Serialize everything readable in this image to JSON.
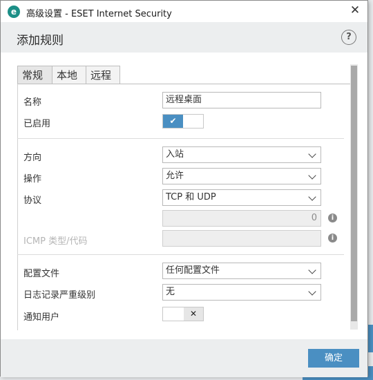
{
  "titlebar": {
    "title": "高级设置 - ESET Internet Security",
    "icon": "eset-logo-icon",
    "app_icon_letter": "e",
    "close_glyph": "✕"
  },
  "header": {
    "title": "添加规则",
    "help_glyph": "?"
  },
  "tabs": [
    {
      "label": "常规",
      "active": true
    },
    {
      "label": "本地"
    },
    {
      "label": "远程"
    }
  ],
  "form": {
    "name": {
      "label": "名称",
      "value": "远程桌面"
    },
    "enabled": {
      "label": "已启用",
      "value": true,
      "check_glyph": "✔"
    },
    "direction": {
      "label": "方向",
      "value": "入站"
    },
    "action": {
      "label": "操作",
      "value": "允许"
    },
    "protocol": {
      "label": "协议",
      "value": "TCP 和 UDP",
      "number_value": "0"
    },
    "icmp": {
      "label": "ICMP 类型/代码",
      "value": "",
      "disabled": true
    },
    "profile": {
      "label": "配置文件",
      "value": "任何配置文件"
    },
    "log_level": {
      "label": "日志记录严重级别",
      "value": "无"
    },
    "notify_user": {
      "label": "通知用户",
      "value": false,
      "x_glyph": "✕"
    }
  },
  "info_glyph": "i",
  "footer": {
    "ok_label": "确定"
  },
  "colors": {
    "accent": "#4a8fc2",
    "header_bg": "#eceeef",
    "app_icon": "#1c8f87"
  }
}
